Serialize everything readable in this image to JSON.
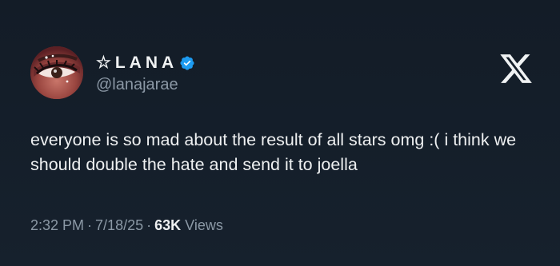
{
  "user": {
    "display_name": "☆LANA",
    "handle": "@lanajarae",
    "verified": true,
    "verified_color": "#1d9bf0"
  },
  "tweet": {
    "text": "everyone is so mad about the result of all stars omg :( i think we should double the hate and send it to joella"
  },
  "meta": {
    "time": "2:32 PM",
    "separator": "·",
    "date": "7/18/25",
    "views_count": "63K",
    "views_label": "Views"
  },
  "icons": {
    "brand": "x-logo-icon",
    "badge": "verified-badge-icon"
  },
  "colors": {
    "background": "#15202b",
    "text": "#e7e9ea",
    "muted": "#8b98a5"
  }
}
